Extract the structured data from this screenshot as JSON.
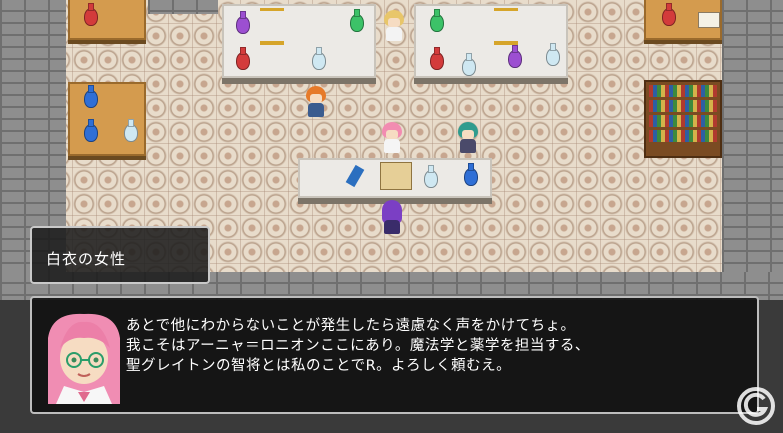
{
  "dialogue": {
    "speaker_name": "白衣の女性",
    "lines": [
      "あとで他にわからないことが発生したら遠慮なく声をかけてちょ。",
      "我こそはアーニャ＝ロニオンここにあり。魔法学と薬学を担当する、",
      "聖グレイトンの智将とは私のことでR。よろしく頼むえ。"
    ]
  },
  "icons": {
    "portrait": "pink-haired-woman-with-glasses-portrait",
    "watermark": "gamer-logo-icon"
  },
  "colors": {
    "window_bg": "#121212",
    "window_border": "#bdbdbd",
    "text": "#ffffff",
    "floor": "#e8dccb",
    "wall": "#8e8e8e"
  }
}
